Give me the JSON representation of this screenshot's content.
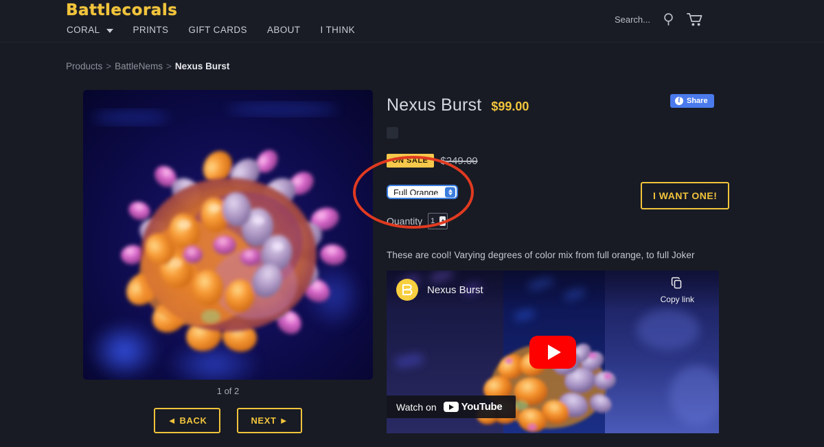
{
  "brand": {
    "logo_text": "Battlecorals",
    "accent_gold": "#f2c43c"
  },
  "header": {
    "nav": [
      {
        "label": "CORAL",
        "has_dropdown": true
      },
      {
        "label": "PRINTS",
        "has_dropdown": false
      },
      {
        "label": "GIFT CARDS",
        "has_dropdown": false
      },
      {
        "label": "ABOUT",
        "has_dropdown": false
      },
      {
        "label": "I THINK",
        "has_dropdown": false
      }
    ],
    "search_label": "Search...",
    "search_icon": "search-icon",
    "cart_icon": "shopping-cart-icon"
  },
  "breadcrumb": {
    "items": [
      "Products",
      "BattleNems"
    ],
    "separator": ">",
    "current": "Nexus Burst"
  },
  "gallery": {
    "pager_count": "1 of 2",
    "back_label": "◄ BACK",
    "next_label": "NEXT ►",
    "image_alt": "Nexus Burst anemone under blue actinic light"
  },
  "product": {
    "title": "Nexus Burst",
    "price": "$99.00",
    "sale_badge": "ON SALE",
    "old_price": "$249.00",
    "variant_selected": "Full Orange",
    "variant_options": [
      "Full Orange"
    ],
    "quantity_label": "Quantity",
    "quantity_value": "1",
    "cta_label": "I WANT ONE!",
    "description": "These are cool!   Varying degrees of color mix from full orange, to full Joker"
  },
  "share": {
    "label": "Share",
    "network": "Facebook",
    "color": "#4a7aec"
  },
  "video": {
    "title": "Nexus Burst",
    "copy_link_label": "Copy link",
    "watch_on_label": "Watch on",
    "platform": "YouTube",
    "channel_initial": "B"
  },
  "annotation": {
    "shape": "ellipse",
    "color": "#e03a20"
  },
  "colors": {
    "page_bg": "#181b24",
    "header_bg": "#191c25",
    "gold": "#f2c43c",
    "sale_yellow": "#f6c84c",
    "text_primary": "#d4d7dd",
    "text_muted": "#8d929c",
    "select_blue": "#3b7ddd",
    "youtube_red": "#ff0000"
  }
}
